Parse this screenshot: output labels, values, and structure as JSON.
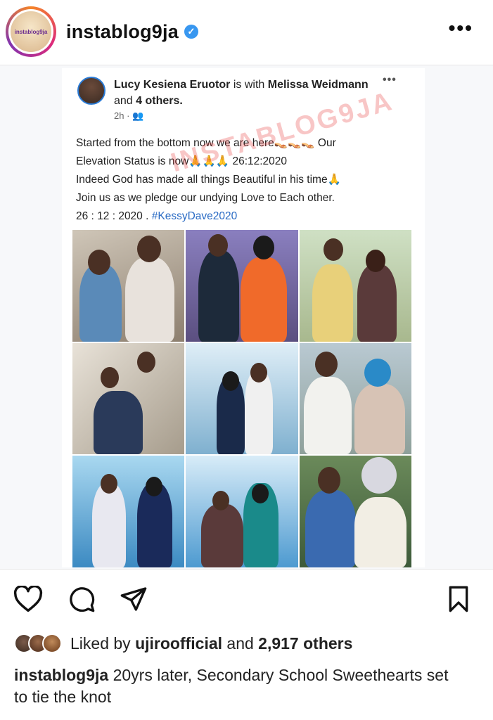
{
  "header": {
    "avatar_text": "instablog9ja",
    "username": "instablog9ja",
    "verified_icon": "check-icon",
    "more_label": "•••"
  },
  "fb_post": {
    "author": "Lucy Kesiena Eruotor",
    "with_text": "is with",
    "tagged": "Melissa Weidmann",
    "and_text": "and",
    "others": "4 others.",
    "time": "2h",
    "more_label": "•••",
    "lines": [
      "Started from the bottom now we are here👡👡👡 Our",
      "Elevation Status is now🙏🙏🙏 26:12:2020",
      "Indeed God has made all things Beautiful in his time🙏",
      "Join us as we pledge our undying Love to Each other."
    ],
    "last_line_prefix": "26 : 12 : 2020 . ",
    "hashtag": "#KessyDave2020",
    "watermark": "INSTABLOG9JA"
  },
  "likes": {
    "prefix": "Liked by",
    "user": "ujiroofficial",
    "middle": "and",
    "count": "2,917 others"
  },
  "caption": {
    "username": "instablog9ja",
    "text": "20yrs later, Secondary School Sweethearts set to tie the knot"
  },
  "colors": {
    "verified": "#3897f0",
    "hashtag": "#2a6bc4",
    "watermark": "#e63232"
  }
}
